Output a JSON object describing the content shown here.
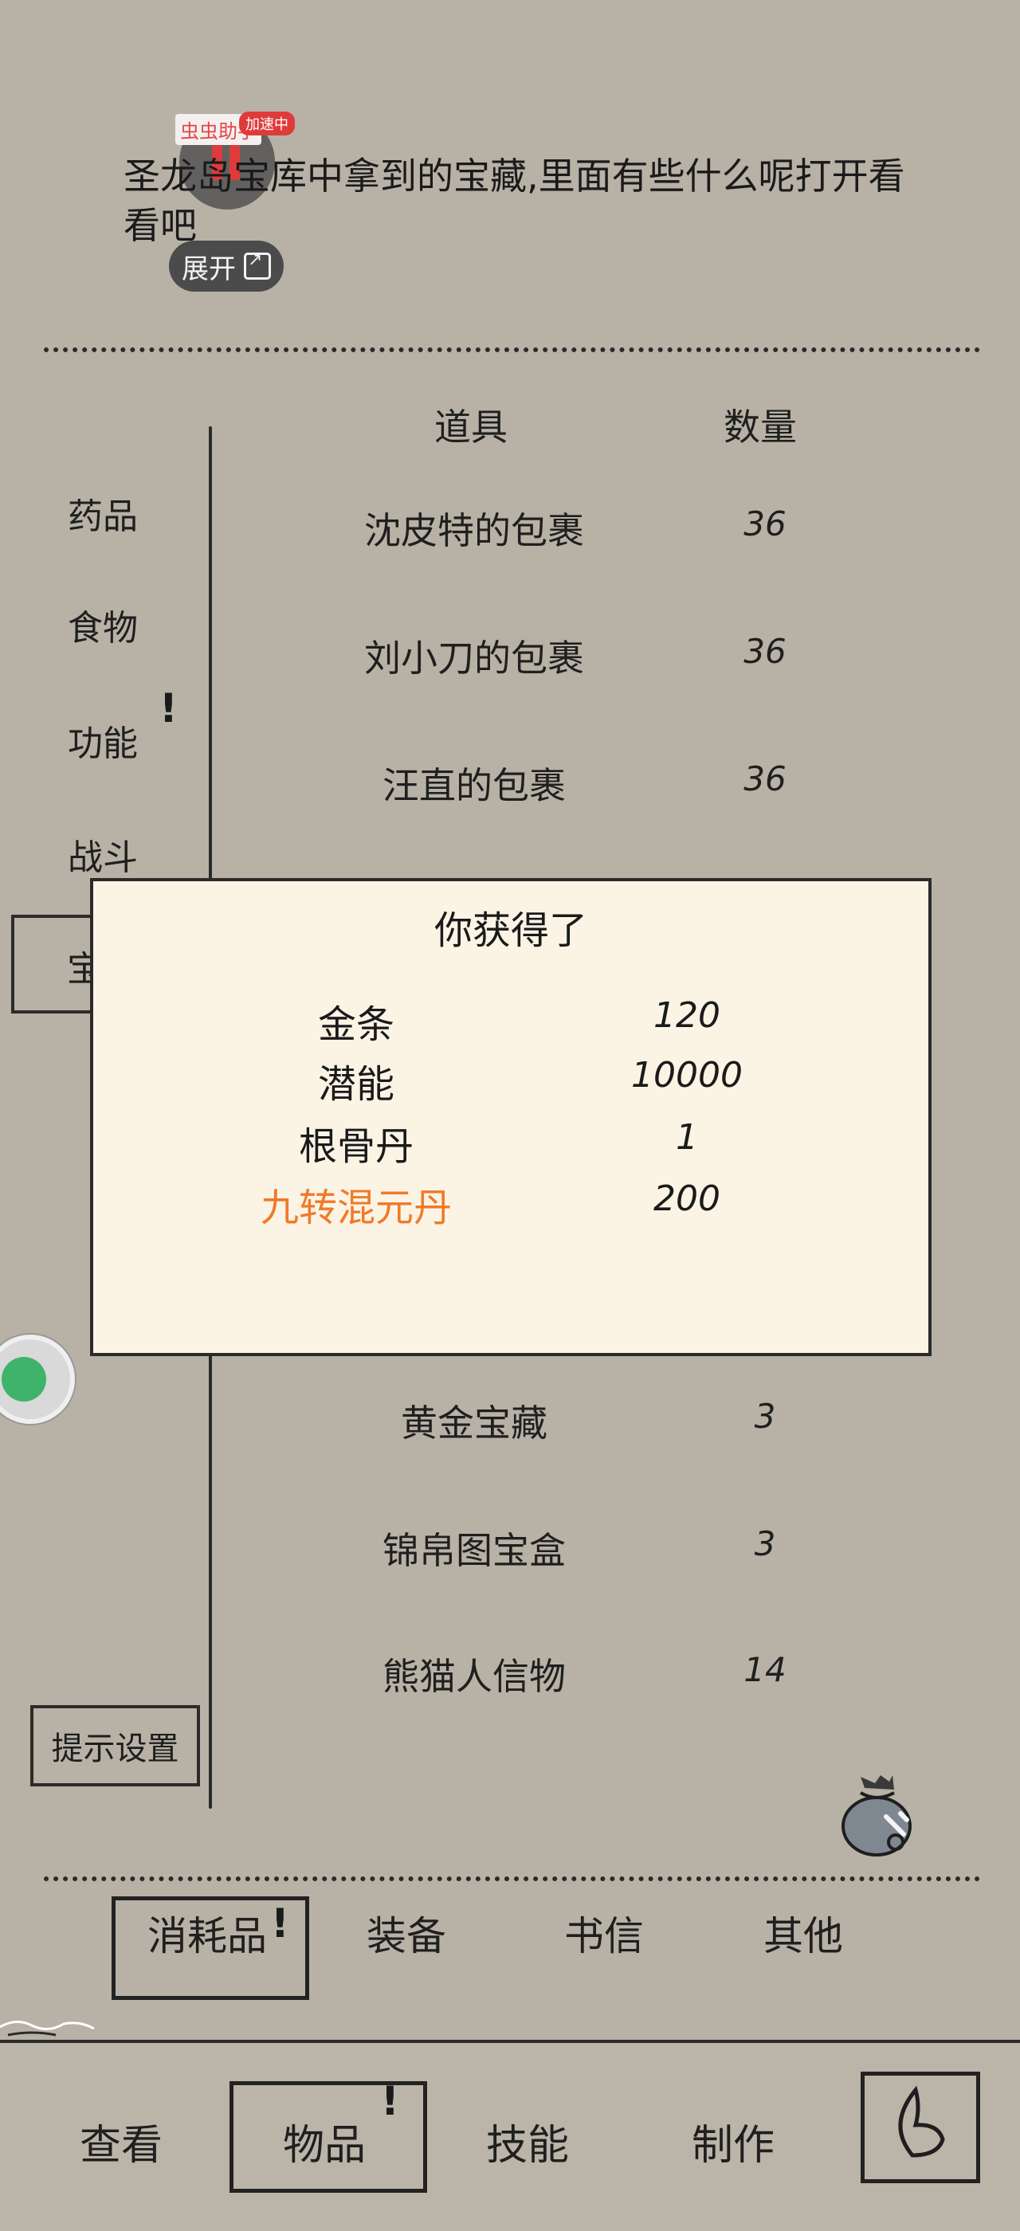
{
  "overlay": {
    "helper_label": "虫虫助手",
    "speed_badge": "加速中"
  },
  "story": {
    "text": "圣龙岛宝库中拿到的宝藏,里面有些什么呢打开看看吧",
    "expand_label": "展开"
  },
  "categories": {
    "medicine": "药品",
    "food": "食物",
    "function": "功能",
    "function_alert": "!",
    "battle": "战斗",
    "treasure_partial": "宝"
  },
  "table": {
    "col_item": "道具",
    "col_qty": "数量",
    "rows_top": [
      {
        "name": "沈皮特的包裹",
        "qty": "36"
      },
      {
        "name": "刘小刀的包裹",
        "qty": "36"
      },
      {
        "name": "汪直的包裹",
        "qty": "36"
      }
    ],
    "rows_bottom": [
      {
        "name": "黄金宝藏",
        "qty": "3"
      },
      {
        "name": "锦帛图宝盒",
        "qty": "3"
      },
      {
        "name": "熊猫人信物",
        "qty": "14"
      }
    ]
  },
  "hint_settings": "提示设置",
  "modal": {
    "title": "你获得了",
    "rewards": [
      {
        "name": "金条",
        "qty": "120"
      },
      {
        "name": "潜能",
        "qty": "10000"
      },
      {
        "name": "根骨丹",
        "qty": "1"
      },
      {
        "name": "九转混元丹",
        "qty": "200"
      }
    ],
    "highlight_color": "#f07a2a"
  },
  "subtabs": {
    "consumables": "消耗品",
    "consumables_alert": "!",
    "equipment": "装备",
    "letters": "书信",
    "other": "其他"
  },
  "nav": {
    "view": "查看",
    "items": "物品",
    "items_alert": "!",
    "skills": "技能",
    "craft": "制作"
  }
}
